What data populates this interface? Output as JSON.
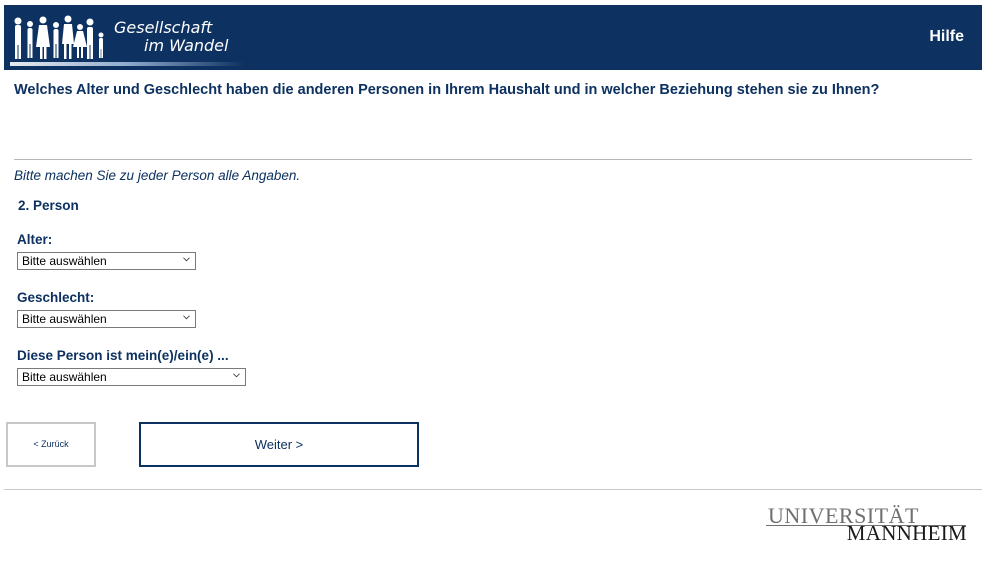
{
  "header": {
    "logo_line1": "Gesellschaft",
    "logo_line2": "im Wandel",
    "help_label": "Hilfe"
  },
  "question": "Welches Alter und Geschlecht haben die anderen Personen in Ihrem Haushalt und in welcher Beziehung stehen sie zu Ihnen?",
  "instruction": "Bitte machen Sie zu jeder Person alle Angaben.",
  "person_title": "2. Person",
  "fields": {
    "age": {
      "label": "Alter:",
      "value": "Bitte auswählen"
    },
    "gender": {
      "label": "Geschlecht:",
      "value": "Bitte auswählen"
    },
    "relation": {
      "label": "Diese Person ist mein(e)/ein(e) ...",
      "value": "Bitte auswählen"
    }
  },
  "buttons": {
    "back_label": "< Zurück",
    "next_label": "Weiter >"
  },
  "university": {
    "line1": "UNIVERSITÄT",
    "line2": "MANNHEIM"
  },
  "colors": {
    "brand_navy": "#0d3160",
    "divider_gray": "#b5b5b5"
  }
}
